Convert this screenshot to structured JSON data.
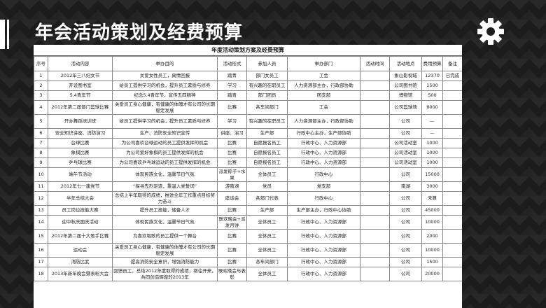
{
  "slide": {
    "title": "年会活动策划及经费预算"
  },
  "sheet": {
    "title": "年度活动策划方案及经费预算",
    "columns": [
      "序号",
      "活动内容",
      "举办目的",
      "活动形式",
      "参加人员",
      "举办部门",
      "活动时间",
      "活动地点",
      "费用预算",
      "备注"
    ],
    "rows": [
      [
        "1",
        "2012年三八妇女节",
        "关爱女性员工，真情回报",
        "踏青",
        "部门女员工",
        "工会",
        "",
        "象山影视城",
        "12370",
        "已完成"
      ],
      [
        "2",
        "开设图书室",
        "给员工提供学习的机会，提升员工素质与修养",
        "学习",
        "有兴趣的在职员工",
        "人力资源部主办，行政部协助",
        "",
        "公司图书馆",
        "1500",
        ""
      ],
      [
        "3",
        "5.4青年节",
        "纪念5.4青年节，宣传五四精神",
        "踏青",
        "部门团员",
        "团支部",
        "",
        "博物馆",
        "500",
        ""
      ],
      [
        "4",
        "2012年第二届部门篮球比赛",
        "关爱员工身心健康，有健康的体魄才有公司的长期稳定发展",
        "比赛",
        "各车间部门",
        "工会",
        "",
        "公司篮球场",
        "8000",
        ""
      ],
      [
        "5",
        "开办舞蹈培训班",
        "给员工提供学习的机会，提升员工素质与修养",
        "学习",
        "有兴趣的在职员工",
        "人力资源部主办，行政部协助",
        "",
        "公司",
        "—",
        ""
      ],
      [
        "6",
        "安全知识讲座、消防演习",
        "生产、消防安全知识宣传",
        "讲座、演习",
        "生产部",
        "行政中心主办，生产部协助",
        "",
        "公司",
        "—",
        ""
      ],
      [
        "7",
        "台球比赛",
        "为公司喜欢台球运动的员工提供发挥的机会",
        "比赛",
        "自愿报名员工",
        "行政中心、人力资源部",
        "",
        "公司活动室",
        "1000",
        ""
      ],
      [
        "8",
        "象棋比赛",
        "为公司爱好象棋的员工提供发挥的机会",
        "比赛",
        "自愿报名员工",
        "行政中心、人力资源部",
        "",
        "公司活动室",
        "1000",
        ""
      ],
      [
        "9",
        "乒乓球比赛",
        "为公司喜欢乒乓球运动的员工提供发挥的机会",
        "比赛",
        "自愿报名员工",
        "行政中心、人力资源部",
        "",
        "公司活动室",
        "1000",
        ""
      ],
      [
        "10",
        "端午节活动",
        "体现民族文化，温馨节日气氛",
        "派发粽子+水果",
        "全体员工",
        "行政中心",
        "",
        "公司",
        "15000",
        ""
      ],
      [
        "11",
        "2012年七一建党节",
        "“探寻先烈足迹，重温入党誓词”",
        "游南湖",
        "党员",
        "党支部",
        "",
        "南湖",
        "3000",
        ""
      ],
      [
        "12",
        "半年总结大会",
        "总结上半年取得的成绩，推进全年工作重点目标努力奋斗",
        "座谈会",
        "各部门代表",
        "行政中心",
        "",
        "公司",
        "未算",
        ""
      ],
      [
        "13",
        "员工岗位技能大赛",
        "提升员工技能，储备人才",
        "比赛",
        "生产部",
        "生产部主办，行政中心协助",
        "",
        "公司",
        "45000",
        ""
      ],
      [
        "14",
        "迎中秋庆国庆活动",
        "体现民族文化，温馨节日气氛",
        "联欢晚会+派发月饼",
        "全体员工",
        "行政中心、人力资源部",
        "",
        "公司",
        "10000",
        ""
      ],
      [
        "15",
        "2012年第二届十大歌手比赛",
        "为喜欢唱歌的员工提供一个舞台",
        "比赛",
        "全体员工",
        "行政中心、人力资源部",
        "",
        "公司",
        "2000",
        ""
      ],
      [
        "16",
        "运动会",
        "关爱员工身心健康，有健康的体魄才有公司的长期稳定发展",
        "比赛",
        "全体员工",
        "行政中心、人力资源部",
        "",
        "公司",
        "10000",
        ""
      ],
      [
        "17",
        "消防比武",
        "提高消防安全意识，增强消防能力",
        "比赛",
        "各车间部门",
        "行政中心、人力资源部",
        "",
        "公司",
        "1500",
        ""
      ],
      [
        "18",
        "2013年新年晚会暨表彰大会",
        "回馈员工，总结2012年度取得的成绩，继往开来，共同创造辉煌的2013年",
        "联欢晚会与表彰",
        "全体员工",
        "行政中心、人力资源部",
        "",
        "公司",
        "20000",
        ""
      ]
    ],
    "tall_rows": [
      4,
      5,
      10,
      12,
      14,
      15,
      16,
      18
    ]
  },
  "icons": {
    "settings": "gear-icon"
  },
  "colors": {
    "accent": "#ffffff",
    "background": "#1c1c1c"
  }
}
